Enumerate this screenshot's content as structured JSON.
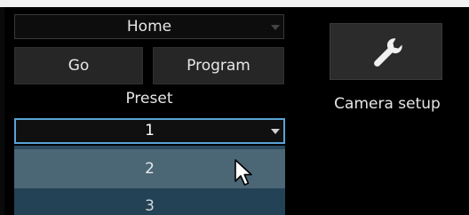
{
  "home_select": {
    "value": "Home",
    "icon": "chevron-down-icon"
  },
  "buttons": {
    "go_label": "Go",
    "program_label": "Program"
  },
  "preset": {
    "label": "Preset",
    "selected_value": "1",
    "options": [
      "2",
      "3"
    ],
    "highlighted_option": "2"
  },
  "camera_setup": {
    "label": "Camera setup",
    "icon": "wrench-icon"
  },
  "colors": {
    "background": "#000000",
    "button": "#262626",
    "focus_border": "#5aa3d6",
    "dropdown_bg": "#2b4a5e",
    "dropdown_highlight": "#4b6675"
  }
}
